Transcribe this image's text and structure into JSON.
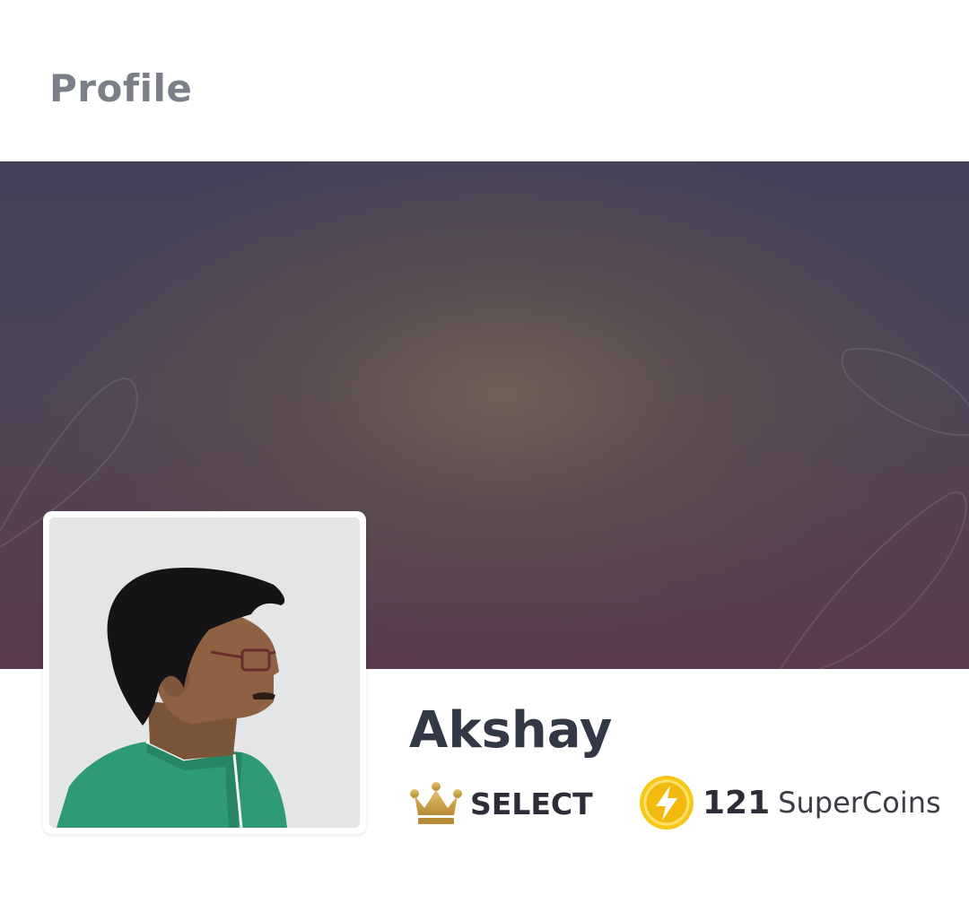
{
  "header": {
    "title": "Profile"
  },
  "profile": {
    "name": "Akshay",
    "membership": {
      "label": "SELECT",
      "icon": "crown-icon",
      "color": "#c9a04a"
    },
    "supercoins": {
      "count": "121",
      "label": "SuperCoins",
      "icon": "lightning-coin-icon",
      "color": "#f6c51b"
    },
    "avatar": {
      "alt": "profile photo"
    }
  },
  "colors": {
    "title": "#7b7f88",
    "name": "#333846"
  }
}
